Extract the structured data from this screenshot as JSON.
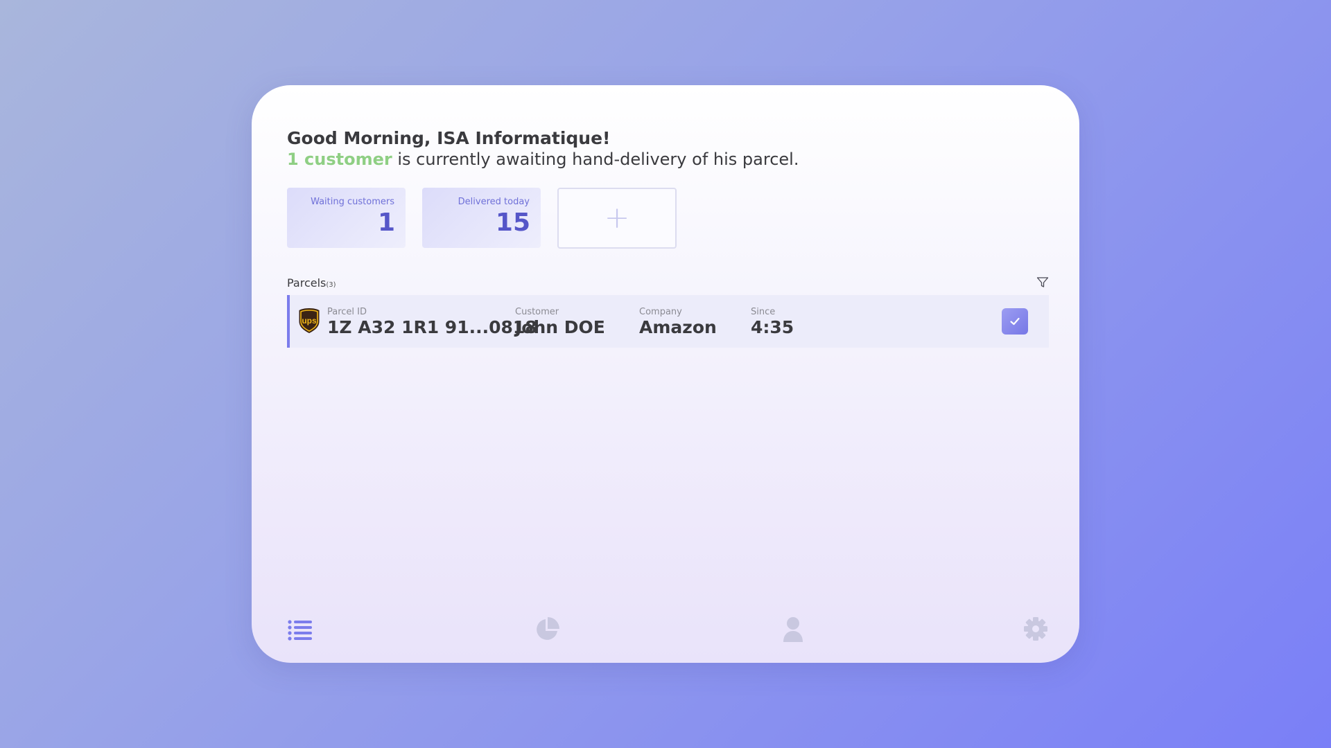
{
  "header": {
    "greeting": "Good Morning, ISA Informatique!",
    "highlight": "1 customer",
    "message": " is currently awaiting hand-delivery of his parcel."
  },
  "stats": [
    {
      "label": "Waiting customers",
      "value": "1"
    },
    {
      "label": "Delivered today",
      "value": "15"
    }
  ],
  "add_card": {
    "symbol": "+"
  },
  "parcels": {
    "title": "Parcels",
    "count": "(3)",
    "rows": [
      {
        "carrier_icon": "ups-logo-icon",
        "carrier_text": "ups",
        "parcel_id_label": "Parcel ID",
        "parcel_id": "1Z A32 1R1 91...0818",
        "customer_label": "Customer",
        "customer": "John DOE",
        "company_label": "Company",
        "company": "Amazon",
        "since_label": "Since",
        "since": "4:35"
      }
    ]
  },
  "nav": [
    "list-icon",
    "pie-chart-icon",
    "user-icon",
    "gear-icon"
  ],
  "colors": {
    "accent": "#7b7cec",
    "highlight_green": "#8fcf84",
    "stat_value": "#5556c8",
    "nav_active": "#7b7cec",
    "nav_inactive": "#c9c8e0"
  }
}
